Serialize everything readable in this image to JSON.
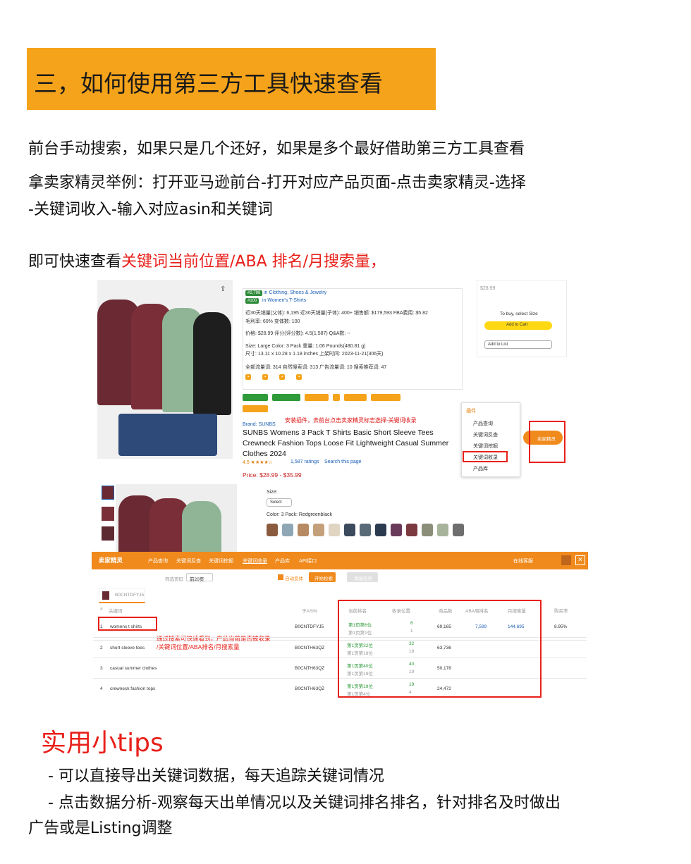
{
  "heading": "三，如何使用第三方工具快速查看",
  "paragraphs": {
    "p1": "前台手动搜索，如果只是几个还好，如果是多个最好借助第三方工具查看",
    "p2_line1": "拿卖家精灵举例：打开亚马逊前台-打开对应产品页面-点击卖家精灵-选择",
    "p2_line2": "-关键词收入-输入对应asin和关键词",
    "p3_prefix": "即可快速查看",
    "p3_highlight": "关键词当前位置/ABA 排名/月搜索量，"
  },
  "product_panel": {
    "rank1": "#2,798",
    "rank1_cat": "in Clothing, Shoes & Jewelry",
    "rank2": "#100",
    "rank2_cat": "in Women's T-Shirts",
    "sales_line": "近30天销量(父体): 6,195   近30天销量(子体): 400+   销售额: $179,593   FBA费用: $5.82",
    "margin_line": "毛利率: 60%   变体数: 100",
    "price_line": "价格: $28.99   评分(评分数): 4.5(1,587)   Q&A数: --",
    "size_line": "Size: Large   Color: 3 Pack   重量: 1.06 Pounds(480.81 g)",
    "dim_line": "尺寸: 13.11 x 10.28 x 1.18 inches   上架时间: 2023-11-21(306天)",
    "kw_line": "全部流量词: 314   自然搜索词: 313   广告流量词: 10   搜索推荐词: 47",
    "plugin_note": "安装插件，去前台点击卖家精灵标志选择-关键词收录",
    "brand": "Brand: SUNBS",
    "title1": "SUNBS Womens 3 Pack T Shirts Basic Short Sleeve Tees",
    "title2": "Crewneck Fashion Tops Loose Fit Lightweight Casual Summer",
    "title3": "Clothes 2024",
    "rating": "4.5 ★★★★☆",
    "ratings_count": "1,587 ratings",
    "search_page": "Search this page",
    "price": "Price: $28.99 - $35.99",
    "buy_price": "$28.99",
    "to_buy": "To buy, select Size",
    "add_cart": "Add to Cart",
    "add_list": "Add to List",
    "size_label": "Size:",
    "select_label": "Select",
    "color_label": "Color: 3 Pack: Redgreenblack"
  },
  "plugin_menu": {
    "title": "插件",
    "items": [
      "产品查询",
      "关键词反查",
      "关键词挖掘",
      "关键词收录",
      "产品库"
    ],
    "badge": "卖家精灵"
  },
  "tool": {
    "logo": "卖家精灵",
    "nav": [
      "产品查询",
      "关键词反查",
      "关键词挖掘",
      "关键词收录",
      "产品库",
      "API接口"
    ],
    "nav_right": "在线客服",
    "filter_label": "筛选页码",
    "pages": "前20页",
    "check_label": "自动变体",
    "start_btn": "开始检索",
    "export_btn": "添加任务",
    "asin_tab": "B0CNTDFYJ5",
    "columns": [
      "#",
      "关键词",
      "子ASIN",
      "当前排名",
      "收录位置",
      "商品数",
      "ABA周排名",
      "月搜索量",
      "购买率"
    ],
    "rows": [
      {
        "idx": "1",
        "kw": "womens t shirts",
        "asin": "B0CNTDFYJ5",
        "rank_a": "第1页第6位",
        "rank_b": "第1页第1位",
        "pos_a": "6",
        "pos_b": "1",
        "products": "69,165",
        "aba": "7,599",
        "search": "144,695",
        "rate": "8.95%"
      },
      {
        "idx": "2",
        "kw": "short sleeve tees",
        "asin": "B0CNTH63QZ",
        "rank_a": "第1页第32位",
        "rank_b": "第1页第18位",
        "pos_a": "32",
        "pos_b": "18",
        "products": "63,736",
        "aba": "",
        "search": "",
        "rate": ""
      },
      {
        "idx": "3",
        "kw": "casual summer clothes",
        "asin": "B0CNTH63QZ",
        "rank_a": "第1页第40位",
        "rank_b": "第1页第19位",
        "pos_a": "40",
        "pos_b": "19",
        "products": "50,178",
        "aba": "",
        "search": "",
        "rate": ""
      },
      {
        "idx": "4",
        "kw": "crewneck fashion tops",
        "asin": "B0CNTH63QZ",
        "rank_a": "第1页第19位",
        "rank_b": "第1页第4位",
        "pos_a": "19",
        "pos_b": "4",
        "products": "24,472",
        "aba": "",
        "search": "",
        "rate": ""
      }
    ],
    "annotation_l1": "通过搜索可快速看到，产品当前是否被收录",
    "annotation_l2": "/关键词位置/ABA排名/月搜索量"
  },
  "tips": {
    "title": "实用小tips",
    "t1": "- 可以直接导出关键词数据，每天追踪关键词情况",
    "t2_l1": "- 点击数据分析-观察每天出单情况以及关键词排名排名，针对排名及时做出",
    "t2_l2": "广告或是Listing调整"
  },
  "colors": {
    "banner": "#f5a31a",
    "highlight": "#e8201a",
    "tool_bar": "#f08a1c"
  }
}
